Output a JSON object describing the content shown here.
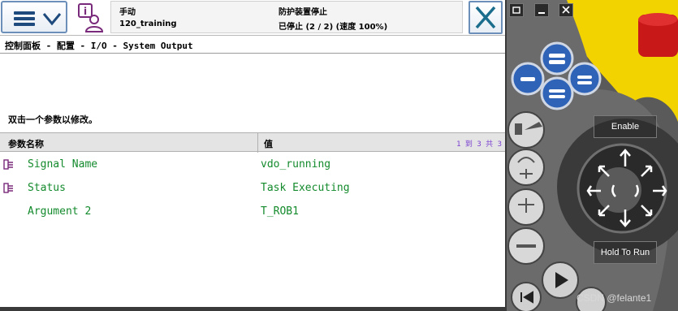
{
  "status": {
    "mode": "手动",
    "system": "120_training",
    "state": "防护装置停止",
    "speed": "已停止 (2 / 2) (速度 100%)"
  },
  "page_title": "控制面板 - 配置 - I/O - System Output",
  "instruction": "双击一个参数以修改。",
  "table": {
    "col_name": "参数名称",
    "col_value": "值",
    "page_info": "1 到 3 共 3",
    "rows": [
      {
        "name": "Signal Name",
        "value": "vdo_running",
        "has_icon": true
      },
      {
        "name": "Status",
        "value": "Task Executing",
        "has_icon": true
      },
      {
        "name": "Argument 2",
        "value": "T_ROB1",
        "has_icon": false
      }
    ]
  },
  "pendant": {
    "enable_label": "Enable",
    "hold_label": "Hold To Run",
    "watermark": "CSDN @felante1"
  },
  "colors": {
    "accent": "#1f4a7d",
    "value_green": "#138a2c",
    "close_teal": "#1a6d8c",
    "estop_red": "#d92020",
    "pendant_yellow": "#f2d300"
  },
  "icons": {
    "menu": "hamburger-icon",
    "user": "user-info-icon",
    "quickset": "quickset-icon",
    "close": "close-icon",
    "row": "signal-param-icon"
  }
}
